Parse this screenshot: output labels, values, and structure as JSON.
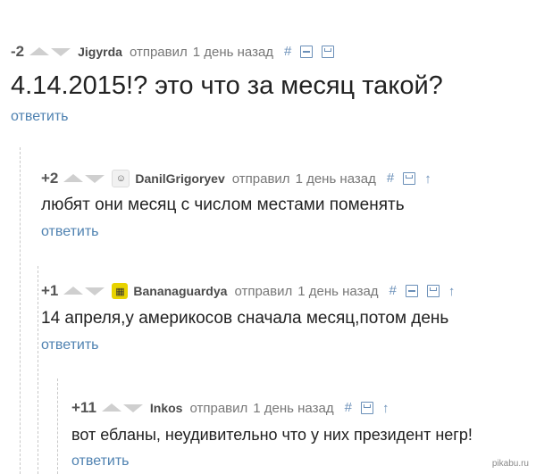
{
  "comments": [
    {
      "rating": "-2",
      "username": "Jigyrda",
      "sent": "отправил",
      "time": "1 день назад",
      "text": "4.14.2015!? это что за месяц такой?",
      "reply": "ответить",
      "tools": [
        "hash-icon",
        "collapse-icon",
        "save-icon"
      ]
    },
    {
      "rating": "+2",
      "username": "DanilGrigoryev",
      "avatar_icon": "avatar-icon",
      "sent": "отправил",
      "time": "1 день назад",
      "text": "любят они месяц с числом местами поменять",
      "reply": "ответить",
      "tools": [
        "hash-icon",
        "save-icon",
        "parent-arrow-icon"
      ]
    },
    {
      "rating": "+1",
      "username": "Bananaguardya",
      "avatar_icon": "avatar-icon",
      "sent": "отправил",
      "time": "1 день назад",
      "text": "14 апреля,у америкосов сначала месяц,потом день",
      "reply": "ответить",
      "tools": [
        "hash-icon",
        "collapse-icon",
        "save-icon",
        "parent-arrow-icon"
      ]
    },
    {
      "rating": "+11",
      "username": "Inkos",
      "sent": "отправил",
      "time": "1 день назад",
      "text": "вот ебланы, неудивительно что у них президент негр!",
      "reply": "ответить",
      "tools": [
        "hash-icon",
        "save-icon",
        "parent-arrow-icon"
      ]
    }
  ],
  "icons": {
    "hash": "#",
    "up": "↑"
  },
  "colors": {
    "accent": "#4f82b1",
    "vote_arrows": "#cfcfcf"
  },
  "watermark": "pikabu.ru"
}
